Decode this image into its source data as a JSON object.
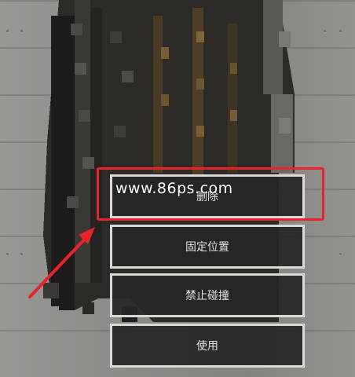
{
  "menu": {
    "items": [
      {
        "label": "删除"
      },
      {
        "label": "固定位置"
      },
      {
        "label": "禁止碰撞"
      },
      {
        "label": "使用"
      }
    ]
  },
  "watermark": "www.86ps.com",
  "colors": {
    "highlight": "#e8232b",
    "button_bg": "#262626",
    "button_border": "#d9d9d9",
    "background": "#8d8b88"
  }
}
